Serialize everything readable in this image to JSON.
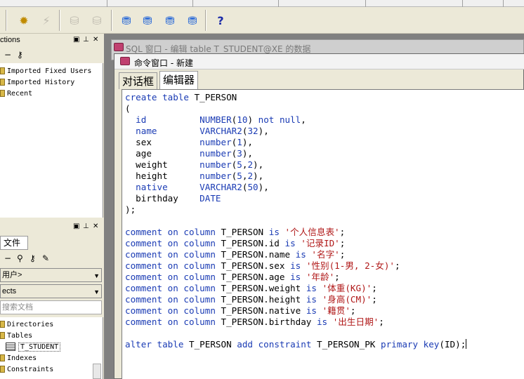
{
  "left": {
    "connections": {
      "title": "ctions",
      "items": [
        "Imported Fixed Users",
        "Imported History",
        "Recent"
      ]
    },
    "objects": {
      "tab_files": "文件",
      "user_combo": "用户>",
      "type_combo": "ects",
      "search_placeholder": "搜索文档",
      "tree": [
        "Directories",
        "Tables",
        "T_STUDENT",
        "Indexes",
        "Constraints"
      ]
    }
  },
  "mdi": {
    "background_window_title": "SQL 窗口 - 编辑 table T_STUDENT@XE 的数据",
    "command_window": {
      "title": "命令窗口 - 新建",
      "tabs": [
        "对话框",
        "编辑器"
      ],
      "active_tab": "编辑器"
    }
  },
  "editor": {
    "lines": [
      [
        [
          "kw",
          "create table "
        ],
        [
          "id",
          "T_PERSON"
        ]
      ],
      [
        [
          "p",
          "("
        ]
      ],
      [
        [
          "p",
          "  "
        ],
        [
          "kw",
          "id"
        ],
        [
          "p",
          "          "
        ],
        [
          "kw",
          "NUMBER"
        ],
        [
          "p",
          "("
        ],
        [
          "kw",
          "10"
        ],
        [
          "p",
          ") "
        ],
        [
          "kw",
          "not null"
        ],
        [
          "p",
          ","
        ]
      ],
      [
        [
          "p",
          "  "
        ],
        [
          "kw",
          "name"
        ],
        [
          "p",
          "        "
        ],
        [
          "kw",
          "VARCHAR2"
        ],
        [
          "p",
          "("
        ],
        [
          "kw",
          "32"
        ],
        [
          "p",
          "),"
        ]
      ],
      [
        [
          "p",
          "  sex         "
        ],
        [
          "kw",
          "number"
        ],
        [
          "p",
          "("
        ],
        [
          "kw",
          "1"
        ],
        [
          "p",
          "),"
        ]
      ],
      [
        [
          "p",
          "  age         "
        ],
        [
          "kw",
          "number"
        ],
        [
          "p",
          "("
        ],
        [
          "kw",
          "3"
        ],
        [
          "p",
          "),"
        ]
      ],
      [
        [
          "p",
          "  weight      "
        ],
        [
          "kw",
          "number"
        ],
        [
          "p",
          "("
        ],
        [
          "kw",
          "5"
        ],
        [
          "p",
          ","
        ],
        [
          "kw",
          "2"
        ],
        [
          "p",
          "),"
        ]
      ],
      [
        [
          "p",
          "  height      "
        ],
        [
          "kw",
          "number"
        ],
        [
          "p",
          "("
        ],
        [
          "kw",
          "5"
        ],
        [
          "p",
          ","
        ],
        [
          "kw",
          "2"
        ],
        [
          "p",
          "),"
        ]
      ],
      [
        [
          "p",
          "  "
        ],
        [
          "kw",
          "native"
        ],
        [
          "p",
          "      "
        ],
        [
          "kw",
          "VARCHAR2"
        ],
        [
          "p",
          "("
        ],
        [
          "kw",
          "50"
        ],
        [
          "p",
          "),"
        ]
      ],
      [
        [
          "p",
          "  birthday    "
        ],
        [
          "kw",
          "DATE"
        ]
      ],
      [
        [
          "p",
          ");"
        ]
      ],
      [],
      [
        [
          "kw",
          "comment on column "
        ],
        [
          "p",
          "T_PERSON "
        ],
        [
          "kw",
          "is "
        ],
        [
          "str",
          "'个人信息表'"
        ],
        [
          "p",
          ";"
        ]
      ],
      [
        [
          "kw",
          "comment on column "
        ],
        [
          "p",
          "T_PERSON.id "
        ],
        [
          "kw",
          "is "
        ],
        [
          "str",
          "'记录ID'"
        ],
        [
          "p",
          ";"
        ]
      ],
      [
        [
          "kw",
          "comment on column "
        ],
        [
          "p",
          "T_PERSON.name "
        ],
        [
          "kw",
          "is "
        ],
        [
          "str",
          "'名字'"
        ],
        [
          "p",
          ";"
        ]
      ],
      [
        [
          "kw",
          "comment on column "
        ],
        [
          "p",
          "T_PERSON.sex "
        ],
        [
          "kw",
          "is "
        ],
        [
          "str",
          "'性别(1-男, 2-女)'"
        ],
        [
          "p",
          ";"
        ]
      ],
      [
        [
          "kw",
          "comment on column "
        ],
        [
          "p",
          "T_PERSON.age "
        ],
        [
          "kw",
          "is "
        ],
        [
          "str",
          "'年龄'"
        ],
        [
          "p",
          ";"
        ]
      ],
      [
        [
          "kw",
          "comment on column "
        ],
        [
          "p",
          "T_PERSON.weight "
        ],
        [
          "kw",
          "is "
        ],
        [
          "str",
          "'体重(KG)'"
        ],
        [
          "p",
          ";"
        ]
      ],
      [
        [
          "kw",
          "comment on column "
        ],
        [
          "p",
          "T_PERSON.height "
        ],
        [
          "kw",
          "is "
        ],
        [
          "str",
          "'身高(CM)'"
        ],
        [
          "p",
          ";"
        ]
      ],
      [
        [
          "kw",
          "comment on column "
        ],
        [
          "p",
          "T_PERSON.native "
        ],
        [
          "kw",
          "is "
        ],
        [
          "str",
          "'籍贯'"
        ],
        [
          "p",
          ";"
        ]
      ],
      [
        [
          "kw",
          "comment on column "
        ],
        [
          "p",
          "T_PERSON.birthday "
        ],
        [
          "kw",
          "is "
        ],
        [
          "str",
          "'出生日期'"
        ],
        [
          "p",
          ";"
        ]
      ],
      [],
      [
        [
          "kw",
          "alter table "
        ],
        [
          "p",
          "T_PERSON "
        ],
        [
          "kw",
          "add constraint "
        ],
        [
          "p",
          "T_PERSON_PK "
        ],
        [
          "kw",
          "primary key"
        ],
        [
          "p",
          "(ID);"
        ]
      ]
    ]
  }
}
